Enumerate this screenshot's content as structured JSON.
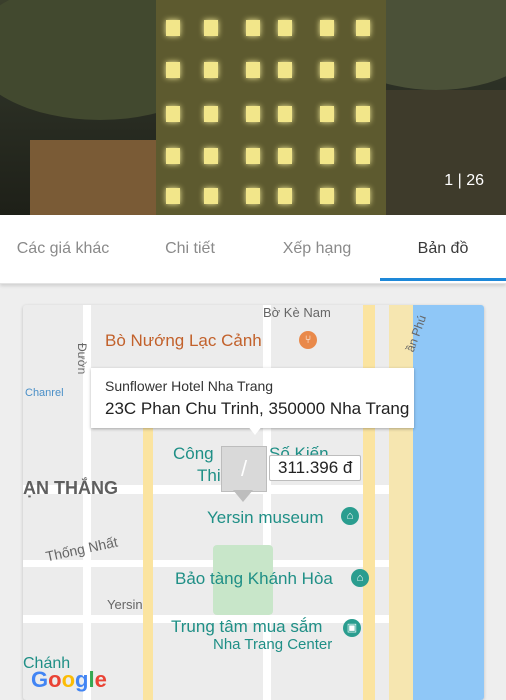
{
  "gallery": {
    "counter": "1 | 26"
  },
  "tabs": [
    {
      "label": "Các giá khác"
    },
    {
      "label": "Chi tiết"
    },
    {
      "label": "Xếp hạng"
    },
    {
      "label": "Bản đồ"
    }
  ],
  "active_tab": "Bản đồ",
  "map": {
    "hotel_name": "Sunflower Hotel Nha Trang",
    "hotel_address": "23C Phan Chu Trinh, 350000 Nha Trang",
    "price": "311.396 đ",
    "labels": {
      "bo_ke_nam": "Bờ Kè Nam",
      "restaurant": "Bò Nướng Lạc Cảnh",
      "duong": "Đườn",
      "tran_phu": "ần Phú",
      "channel": "Chanrel",
      "cong": "Công",
      "so_kien": "Số Kiến",
      "thi": "Thi",
      "van_thang": "ẠN THẮNG",
      "yersin_museum": "Yersin museum",
      "thong_nhat": "Thống Nhất",
      "bao_tang": "Bảo tàng Khánh Hòa",
      "yersin": "Yersin",
      "trung_tam": "Trung tâm mua sắm",
      "nha_trang_center": "Nha Trang Center",
      "chanh": "Chánh",
      "google": "Google"
    }
  },
  "colors": {
    "accent": "#1e88d8",
    "poi_teal": "#1f8f86",
    "poi_orange": "#c2612b",
    "sea": "#8fc7f7"
  }
}
